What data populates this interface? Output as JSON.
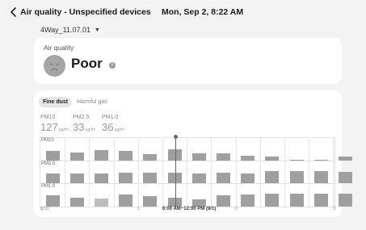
{
  "header": {
    "title": "Air quality - Unspecified devices",
    "datetime": "Mon, Sep 2, 8:22 AM"
  },
  "device": {
    "name": "4Way_11.07.01"
  },
  "air_quality": {
    "label": "Air quality",
    "status": "Poor",
    "info_glyph": "i"
  },
  "tabs": [
    {
      "label": "Fine dust",
      "active": true
    },
    {
      "label": "Harmful gas",
      "active": false
    }
  ],
  "stats": [
    {
      "name": "PM10",
      "value": "127",
      "unit": "µg/m³"
    },
    {
      "name": "PM2.5",
      "value": "33",
      "unit": "µg/m³"
    },
    {
      "name": "PM1.0",
      "value": "36",
      "unit": "µg/m³"
    }
  ],
  "chart": {
    "rows": [
      "PM10",
      "PM2.5",
      "PM1.0"
    ],
    "x_labels": [
      "8/31",
      "1",
      "2",
      "3"
    ],
    "selected_range": "6:00 AM~12:00 PM (9/1)",
    "colors": {
      "bar": "#9f9f9f",
      "bar_light": "#bdbdbd",
      "grid": "#e2e2e2"
    }
  },
  "chart_data": {
    "type": "bar",
    "x_labels": [
      "8/31",
      "1",
      "2",
      "3"
    ],
    "series": [
      {
        "name": "PM10",
        "values": [
          0.55,
          0.5,
          0.62,
          0.58,
          0.38,
          0.68,
          0.45,
          0.45,
          0.3,
          0.25,
          0.05,
          0.05,
          0.25
        ]
      },
      {
        "name": "PM2.5",
        "values": [
          0.58,
          0.58,
          0.58,
          0.65,
          0.65,
          0.65,
          0.58,
          0.65,
          0.62,
          0.75,
          0.75,
          0.75,
          0.68
        ]
      },
      {
        "name": "PM1.0",
        "values": [
          0.68,
          0.52,
          0.5,
          0.7,
          0.6,
          0.52,
          0.45,
          0.68,
          0.72,
          0.78,
          0.78,
          0.75,
          0.78
        ]
      }
    ],
    "light_bars": {
      "PM1.0": [
        2
      ]
    }
  }
}
